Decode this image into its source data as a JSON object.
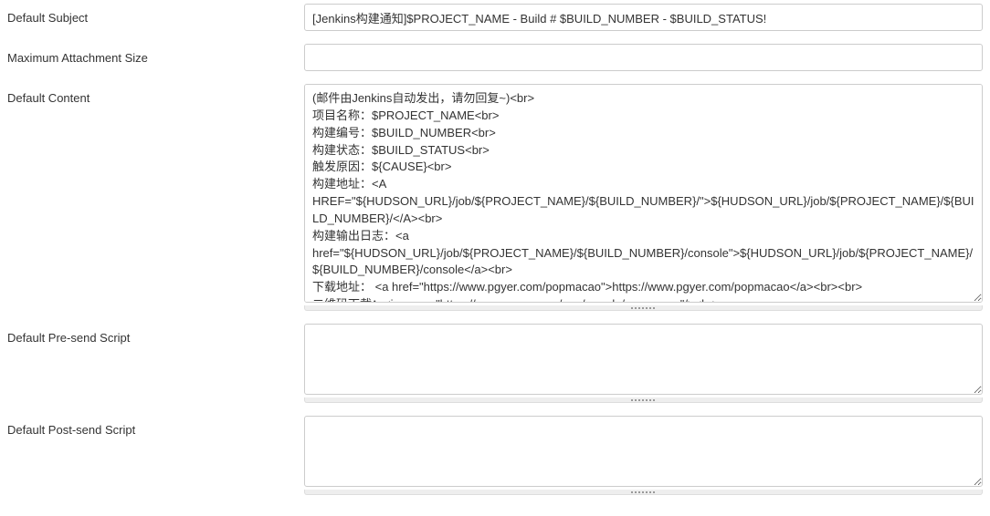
{
  "rows": {
    "defaultSubject": {
      "label": "Default Subject",
      "value": "[Jenkins构建通知]$PROJECT_NAME - Build # $BUILD_NUMBER - $BUILD_STATUS!"
    },
    "maxAttachment": {
      "label": "Maximum Attachment Size",
      "value": ""
    },
    "defaultContent": {
      "label": "Default Content",
      "value": "(邮件由Jenkins自动发出，请勿回复~)<br>\n项目名称：$PROJECT_NAME<br>\n构建编号：$BUILD_NUMBER<br>\n构建状态：$BUILD_STATUS<br>\n触发原因：${CAUSE}<br>\n构建地址：<A HREF=\"${HUDSON_URL}/job/${PROJECT_NAME}/${BUILD_NUMBER}/\">${HUDSON_URL}/job/${PROJECT_NAME}/${BUILD_NUMBER}/</A><br>\n构建输出日志：<a href=\"${HUDSON_URL}/job/${PROJECT_NAME}/${BUILD_NUMBER}/console\">${HUDSON_URL}/job/${PROJECT_NAME}/${BUILD_NUMBER}/console</a><br>\n下载地址： <a href=\"https://www.pgyer.com/popmacao\">https://www.pgyer.com/popmacao</a><br><br>\n二维码下载：<img src=\"https://www.pgyer.com/app/qrcode/popmacao\"/><br>\n最近修改：<br>${CHANGES, showPaths=false, format=\"%a： \\\"%m\\\"<br>\", pathFormat=\"\\n\\t- %p\"}"
    },
    "preSend": {
      "label": "Default Pre-send Script",
      "value": ""
    },
    "postSend": {
      "label": "Default Post-send Script",
      "value": ""
    }
  }
}
